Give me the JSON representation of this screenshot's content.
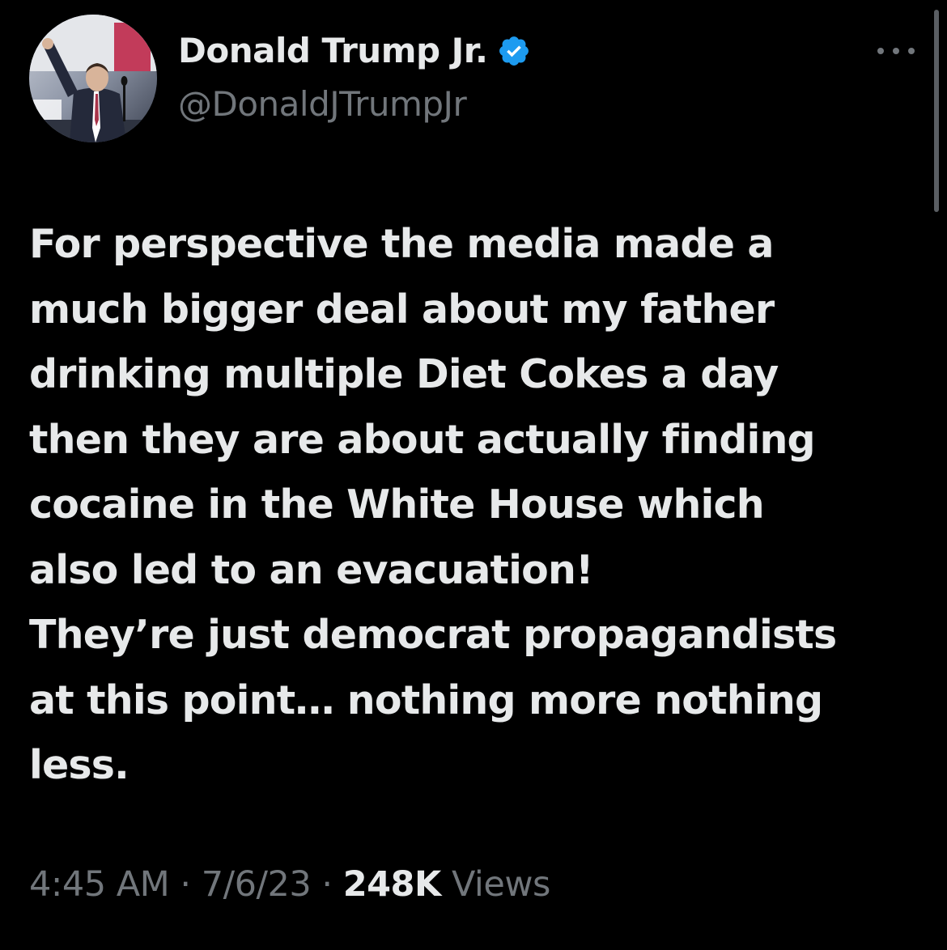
{
  "author": {
    "display_name": "Donald Trump Jr.",
    "handle": "@DonaldJTrumpJr",
    "verified": true,
    "avatar_icon": "profile-photo",
    "verified_icon": "verified-badge-icon"
  },
  "tweet": {
    "text": "For perspective the media made a\nmuch bigger deal about my father\ndrinking multiple Diet Cokes a day\nthen they are about actually finding\ncocaine in the White House which\nalso led to an evacuation!\nThey’re just democrat propagandists\nat this point… nothing more nothing\nless."
  },
  "meta": {
    "time": "4:45 AM",
    "separator": "·",
    "date": "7/6/23",
    "views_count": "248K",
    "views_label": "Views"
  },
  "header": {
    "more_icon": "more-options-icon"
  },
  "colors": {
    "background": "#000000",
    "primary_text": "#e7e9ea",
    "secondary_text": "#71767b",
    "verified_blue": "#1d9bf0"
  }
}
